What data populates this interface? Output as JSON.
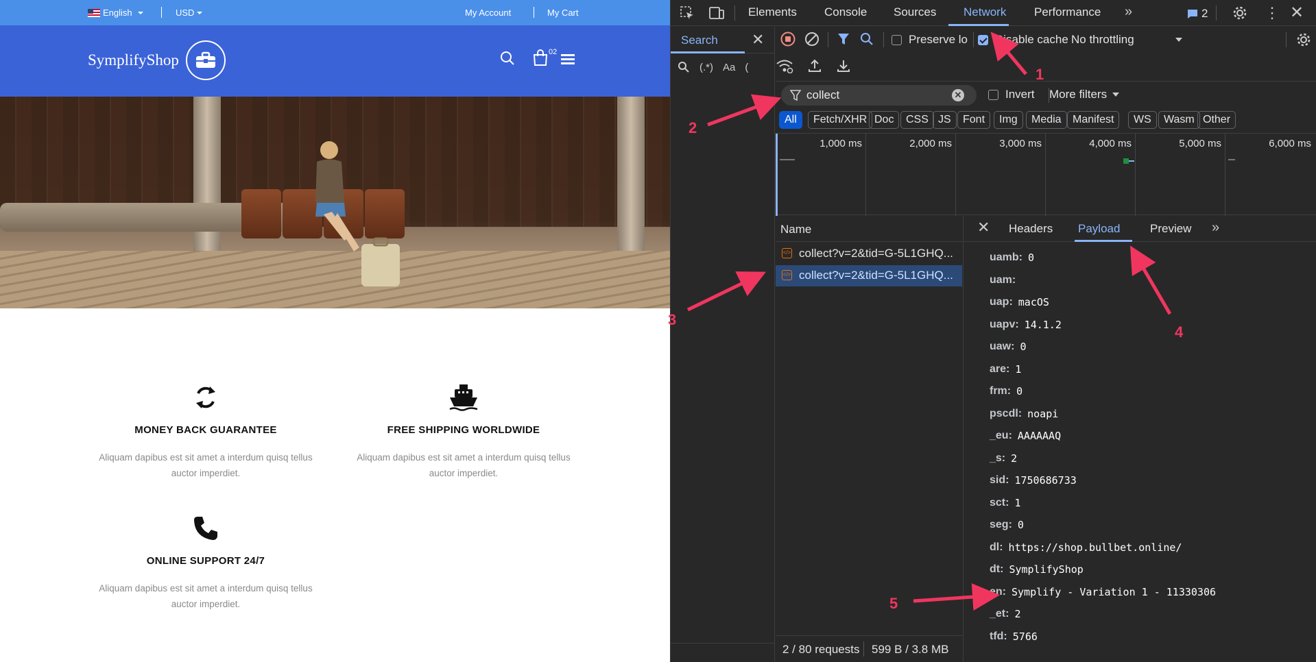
{
  "shop": {
    "topbar": {
      "language": "English",
      "currency": "USD",
      "my_account": "My Account",
      "my_cart": "My Cart"
    },
    "brand": "SymplifyShop",
    "cart_count": "02",
    "features": [
      {
        "title": "MONEY BACK GUARANTEE",
        "desc": "Aliquam dapibus est sit amet a interdum quisq tellus auctor imperdiet.",
        "icon": "refresh-icon"
      },
      {
        "title": "FREE SHIPPING WORLDWIDE",
        "desc": "Aliquam dapibus est sit amet a interdum quisq tellus auctor imperdiet.",
        "icon": "ship-icon"
      },
      {
        "title": "ONLINE SUPPORT 24/7",
        "desc": "Aliquam dapibus est sit amet a interdum quisq tellus auctor imperdiet.",
        "icon": "phone-icon"
      }
    ],
    "colors": {
      "topbar": "#4a90e9",
      "header": "#3b63d8"
    }
  },
  "devtools": {
    "tabs": [
      "Elements",
      "Console",
      "Sources",
      "Network",
      "Performance"
    ],
    "active_tab": "Network",
    "issues_count": "2",
    "search_tab": "Search",
    "search_opts": {
      "regex": "(.*)",
      "case": "Aa"
    },
    "toolbar": {
      "preserve_log": "Preserve lo",
      "disable_cache": "Disable cache",
      "throttling": "No throttling"
    },
    "filter": {
      "value": "collect",
      "invert": "Invert",
      "more_filters": "More filters"
    },
    "type_filters": [
      "All",
      "Fetch/XHR",
      "Doc",
      "CSS",
      "JS",
      "Font",
      "Img",
      "Media",
      "Manifest",
      "WS",
      "Wasm",
      "Other"
    ],
    "timeline_ticks": [
      "1,000 ms",
      "2,000 ms",
      "3,000 ms",
      "4,000 ms",
      "5,000 ms",
      "6,000 ms"
    ],
    "name_header": "Name",
    "requests": [
      "collect?v=2&tid=G-5L1GHQ...",
      "collect?v=2&tid=G-5L1GHQ..."
    ],
    "status": {
      "requests": "2 / 80 requests",
      "size": "599 B / 3.8 MB"
    },
    "detail_tabs": [
      "Headers",
      "Payload",
      "Preview"
    ],
    "active_detail_tab": "Payload",
    "payload": [
      {
        "key": "uamb:",
        "value": "0"
      },
      {
        "key": "uam:",
        "value": ""
      },
      {
        "key": "uap:",
        "value": "macOS"
      },
      {
        "key": "uapv:",
        "value": "14.1.2"
      },
      {
        "key": "uaw:",
        "value": "0"
      },
      {
        "key": "are:",
        "value": "1"
      },
      {
        "key": "frm:",
        "value": "0"
      },
      {
        "key": "pscdl:",
        "value": "noapi"
      },
      {
        "key": "_eu:",
        "value": "AAAAAAQ"
      },
      {
        "key": "_s:",
        "value": "2"
      },
      {
        "key": "sid:",
        "value": "1750686733"
      },
      {
        "key": "sct:",
        "value": "1"
      },
      {
        "key": "seg:",
        "value": "0"
      },
      {
        "key": "dl:",
        "value": "https://shop.bullbet.online/"
      },
      {
        "key": "dt:",
        "value": "SymplifyShop"
      },
      {
        "key": "en:",
        "value": "Symplify - Variation 1 - 11330306"
      },
      {
        "key": "_et:",
        "value": "2"
      },
      {
        "key": "tfd:",
        "value": "5766"
      }
    ],
    "colors": {
      "accent": "#8ab4f8",
      "background": "#282828",
      "selected_row": "#2b4a78"
    }
  },
  "annotations": {
    "labels": [
      "1",
      "2",
      "3",
      "4",
      "5"
    ],
    "color": "#f0365f"
  }
}
